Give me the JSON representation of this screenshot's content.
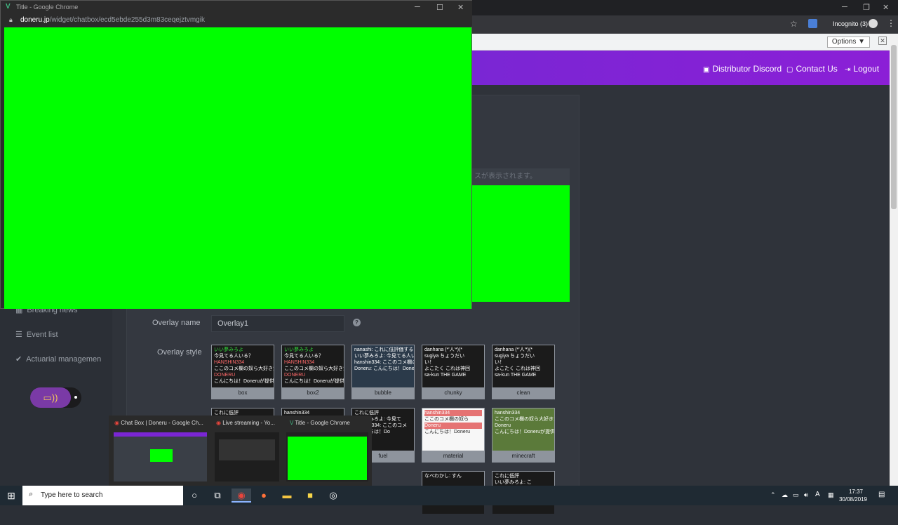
{
  "bg_browser": {
    "incognito_label": "Incognito (3)",
    "options_label": "Options ▼",
    "info_close": "✕"
  },
  "nav": {
    "distributor_discord": "Distributor Discord",
    "contact_us": "Contact Us",
    "logout": "Logout"
  },
  "sidebar": {
    "items": [
      {
        "label": "Breaking news",
        "icon": "grid-icon"
      },
      {
        "label": "Event list",
        "icon": "list-icon"
      },
      {
        "label": "Actuarial managemen",
        "icon": "check-circle-icon"
      }
    ]
  },
  "panel": {
    "hint_text": "スが表示されます。"
  },
  "form": {
    "overlay_name_label": "Overlay name",
    "overlay_name_value": "Overlay1",
    "overlay_style_label": "Overlay style",
    "help": "?"
  },
  "styles": [
    {
      "name": "box",
      "lines": [
        "いい夢みろよ",
        "今見てる人いる？",
        "HANSHIN334",
        "ここのコメ欄の奴ら大好きだ",
        "DONERU",
        "こんにちは！Doneruが提供す"
      ]
    },
    {
      "name": "box2",
      "lines": [
        "いい夢みろよ",
        "今見てる人いる？",
        "HANSHIN334",
        "ここのコメ欄の奴ら大好きだ",
        "DONERU",
        "こんにちは！Doneruが提供す"
      ]
    },
    {
      "name": "bubble",
      "lines": [
        "nanashi: これに低評価する",
        "いい夢みろよ: 今見てる人い",
        "hanshin334: ここのコメ欄の",
        "Doneru: こんにちは！Done"
      ]
    },
    {
      "name": "chunky",
      "lines": [
        "danhana (*'人'*)(*",
        "sugiya ちょうだい",
        "い！",
        "よこたく これは神回",
        "sa-kun THE GAME"
      ]
    },
    {
      "name": "clean",
      "lines": [
        "danhana (*'人'*)(*",
        "sugiya ちょうだい",
        "い！",
        "よこたく これは神回",
        "sa-kun THE GAME"
      ]
    },
    {
      "name": "fuel",
      "lines": [
        "これに低評",
        "いい夢みろよ: 今見て",
        "hanshin334: ここのコメ",
        "こんにちは！Do"
      ]
    },
    {
      "name": "material",
      "lines": [
        "hanshin334",
        "ここのコメ欄の奴ら",
        "Doneru",
        "こんにちは！Doneru"
      ]
    },
    {
      "name": "minecraft",
      "lines": [
        "hanshin334",
        "ここのコメ欄の奴ら大好きだ",
        "Doneru",
        "こんにちは！Doneruが提供する"
      ]
    },
    {
      "name": "",
      "lines": [
        "これに低評"
      ]
    },
    {
      "name": "",
      "lines": [
        "hanshin334"
      ]
    },
    {
      "name": "",
      "lines": [
        "なべわかし: すん"
      ]
    },
    {
      "name": "",
      "lines": [
        "これに低評",
        "いい夢みろよ: こ"
      ]
    }
  ],
  "front_window": {
    "title": "Title - Google Chrome",
    "url_host": "doneru.jp",
    "url_path": "/widget/chatbox/ecd5ebde255d3m83ceqejztvmgik"
  },
  "previews": [
    {
      "title": "Chat Box | Doneru - Google Ch..."
    },
    {
      "title": "Live streaming - Yo..."
    },
    {
      "title": "Title - Google Chrome"
    }
  ],
  "taskbar": {
    "search_placeholder": "Type here to search",
    "time": "17:37",
    "date": "30/08/2019"
  },
  "colors": {
    "chroma_green": "#00ff00",
    "nav_purple": "#8b1fd6"
  }
}
